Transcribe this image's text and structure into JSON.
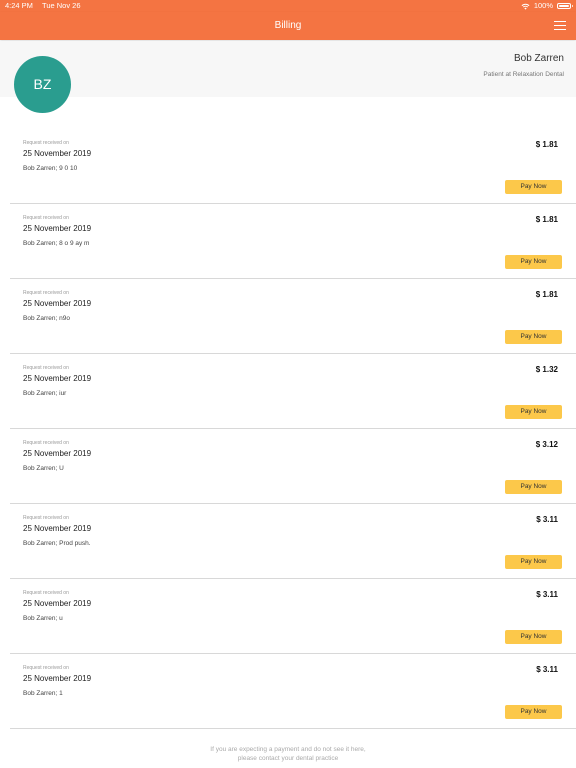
{
  "status_bar": {
    "time": "4:24 PM",
    "date": "Tue Nov 26",
    "battery": "100%"
  },
  "nav": {
    "title": "Billing"
  },
  "profile": {
    "initials": "BZ",
    "name": "Bob Zarren",
    "role": "Patient at Relaxation Dental"
  },
  "bills": [
    {
      "label": "Request received on",
      "date": "25 November 2019",
      "description": "Bob Zarren; 9 0 10",
      "amount": "$ 1.81",
      "button": "Pay Now"
    },
    {
      "label": "Request received on",
      "date": "25 November 2019",
      "description": "Bob Zarren; 8 o 9 ay m",
      "amount": "$ 1.81",
      "button": "Pay Now"
    },
    {
      "label": "Request received on",
      "date": "25 November 2019",
      "description": "Bob Zarren; n9o",
      "amount": "$ 1.81",
      "button": "Pay Now"
    },
    {
      "label": "Request received on",
      "date": "25 November 2019",
      "description": "Bob Zarren; iur",
      "amount": "$ 1.32",
      "button": "Pay Now"
    },
    {
      "label": "Request received on",
      "date": "25 November 2019",
      "description": "Bob Zarren; U",
      "amount": "$ 3.12",
      "button": "Pay Now"
    },
    {
      "label": "Request received on",
      "date": "25 November 2019",
      "description": "Bob Zarren; Prod push.",
      "amount": "$ 3.11",
      "button": "Pay Now"
    },
    {
      "label": "Request received on",
      "date": "25 November 2019",
      "description": "Bob Zarren; u",
      "amount": "$ 3.11",
      "button": "Pay Now"
    },
    {
      "label": "Request received on",
      "date": "25 November 2019",
      "description": "Bob Zarren; 1",
      "amount": "$ 3.11",
      "button": "Pay Now"
    }
  ],
  "footer": {
    "line1": "If you are expecting a payment and do not see it here,",
    "line2": "please contact your dental practice"
  },
  "colors": {
    "brand": "#f47442",
    "avatar": "#2a9d8f",
    "pay_button": "#fcc84a"
  },
  "icons": {
    "wifi": "wifi-icon",
    "battery": "battery-icon",
    "menu": "hamburger-menu-icon"
  }
}
